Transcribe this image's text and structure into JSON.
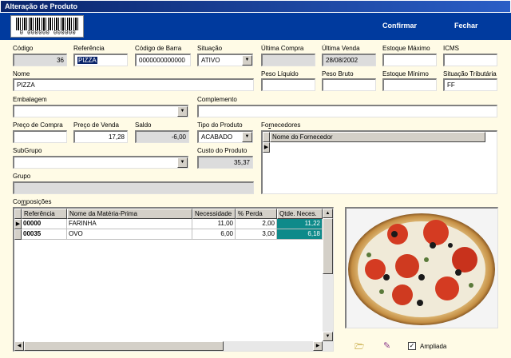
{
  "window": {
    "title": "Alteração de Produto"
  },
  "banner": {
    "barcode_text": "0 000000 000000",
    "confirm_label": "Confirmar",
    "exit_label": "Fechar"
  },
  "fields": {
    "codigo": {
      "label": "Código",
      "value": "36"
    },
    "referencia": {
      "label": "Referência",
      "value": "PIZZA"
    },
    "codigo_barra": {
      "label": "Código de Barra",
      "value": "0000000000000"
    },
    "situacao": {
      "label": "Situação",
      "value": "ATIVO"
    },
    "ultima_compra": {
      "label": "Última Compra",
      "value": ""
    },
    "ultima_venda": {
      "label": "Última Venda",
      "value": "28/08/2002"
    },
    "estoque_maximo": {
      "label": "Estoque Máximo",
      "value": ""
    },
    "icms": {
      "label": "ICMS",
      "value": ""
    },
    "nome": {
      "label": "Nome",
      "value": "PIZZA"
    },
    "peso_liquido": {
      "label": "Peso Líquido",
      "value": ""
    },
    "peso_bruto": {
      "label": "Peso Bruto",
      "value": ""
    },
    "estoque_minimo": {
      "label": "Estoque Mínimo",
      "value": ""
    },
    "situacao_tributaria": {
      "label": "Situação Tributária",
      "value": "FF"
    },
    "embalagem": {
      "label": "Embalagem",
      "value": ""
    },
    "complemento": {
      "label": "Complemento",
      "value": ""
    },
    "preco_compra": {
      "label": "Preço de Compra",
      "value": ""
    },
    "preco_venda": {
      "label": "Preço de Venda",
      "value": "17,28"
    },
    "saldo": {
      "label": "Saldo",
      "value": "-6,00"
    },
    "tipo_produto": {
      "label": "Tipo do Produto",
      "value": "ACABADO"
    },
    "subgrupo": {
      "label": "SubGrupo",
      "value": ""
    },
    "custo_produto": {
      "label": "Custo do Produto",
      "value": "35,37"
    },
    "grupo": {
      "label": "Grupo",
      "value": ""
    }
  },
  "fornecedores": {
    "label_pre": "Fo",
    "label_ul": "r",
    "label_post": "necedores",
    "column": "Nome do Fornecedor"
  },
  "composicoes": {
    "label_pre": "Co",
    "label_ul": "m",
    "label_post": "posições",
    "columns": [
      "Referência",
      "Nome da Matéria-Prima",
      "Necessidade",
      "% Perda",
      "Qtde. Neces."
    ],
    "rows": [
      {
        "ref": "00000",
        "nome": "FARINHA",
        "necessidade": "11,00",
        "perda": "2,00",
        "qtde": "11,22"
      },
      {
        "ref": "00035",
        "nome": "OVO",
        "necessidade": "6,00",
        "perda": "3,00",
        "qtde": "6,18"
      }
    ]
  },
  "image_panel": {
    "ampliada_label": "Ampliada",
    "ampliada_checked": true
  },
  "colors": {
    "titlebar": "#0a246a",
    "banner": "#003a9e",
    "form_bg": "#fffbe6",
    "highlight_cell": "#0e8a8a"
  }
}
